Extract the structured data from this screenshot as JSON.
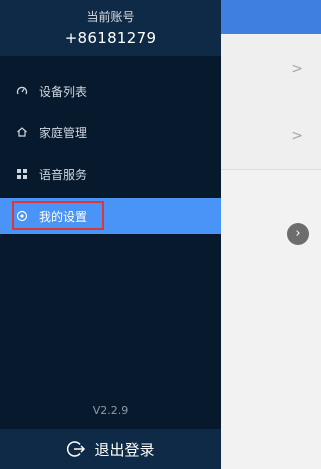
{
  "account": {
    "label": "当前账号",
    "value": "+86181279"
  },
  "menu": {
    "items": [
      {
        "label": "设备列表",
        "icon": "gauge-icon"
      },
      {
        "label": "家庭管理",
        "icon": "home-icon"
      },
      {
        "label": "语音服务",
        "icon": "grid-icon"
      },
      {
        "label": "我的设置",
        "icon": "settings-icon",
        "active": true
      }
    ]
  },
  "version": "V2.2.9",
  "logout": {
    "label": "退出登录"
  },
  "background": {
    "chevrons": [
      ">",
      ">"
    ]
  },
  "colors": {
    "drawer_bg": "#071a2d",
    "header_bg": "#0f2a46",
    "active_bg": "#4a94f7",
    "topbar": "#3f7fe0",
    "highlight": "#d83a3a"
  }
}
